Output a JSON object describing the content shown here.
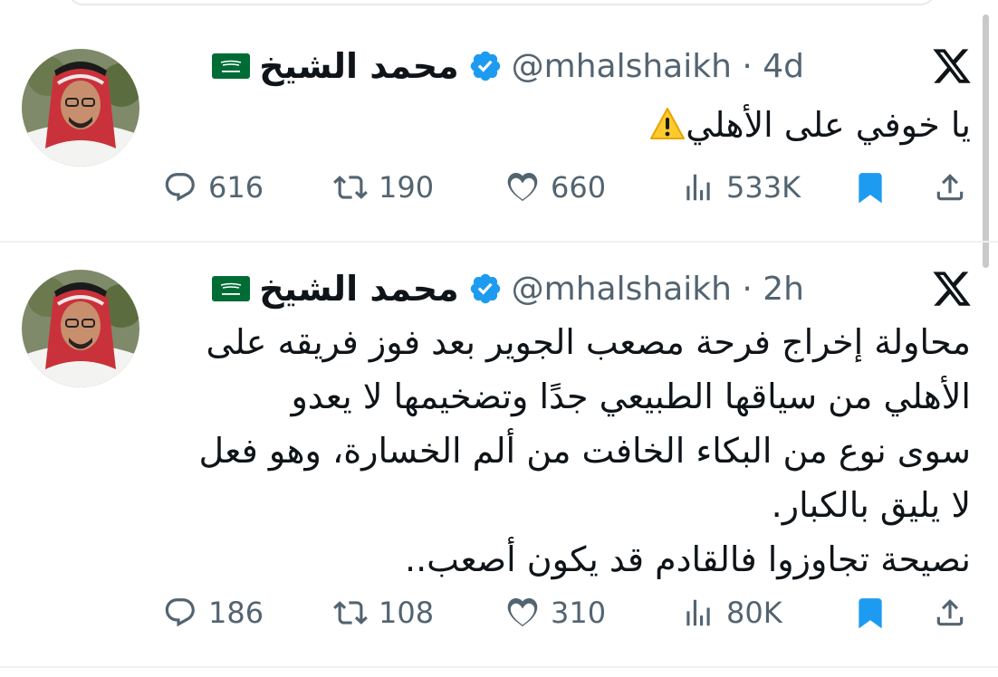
{
  "tweets": [
    {
      "display_name": "محمد الشيخ",
      "handle": "@mhalshaikh",
      "time": "4d",
      "text": "يا خوفي على الأهلي",
      "has_warning_emoji": true,
      "replies": "616",
      "retweets": "190",
      "likes": "660",
      "views": "533K",
      "bookmarked": true
    },
    {
      "display_name": "محمد الشيخ",
      "handle": "@mhalshaikh",
      "time": "2h",
      "text": "محاولة إخراج فرحة مصعب الجوير بعد فوز فريقه على\nالأهلي من سياقها الطبيعي جدًا وتضخيمها لا يعدو\nسوى نوع من البكاء الخافت من ألم الخسارة، وهو فعل\nلا يليق بالكبار.\nنصيحة تجاوزوا فالقادم قد يكون أصعب..",
      "has_warning_emoji": false,
      "replies": "186",
      "retweets": "108",
      "likes": "310",
      "views": "80K",
      "bookmarked": true
    }
  ],
  "colors": {
    "verified": "#1d9bf0",
    "bookmark": "#1d9bf0",
    "flag": "#006c35",
    "muted_text": "#536471",
    "primary_text": "#0f1419"
  },
  "icons": [
    "reply-icon",
    "retweet-icon",
    "like-icon",
    "views-icon",
    "bookmark-icon",
    "share-icon",
    "x-logo-icon",
    "verified-badge-icon",
    "saudi-flag-icon",
    "warning-icon"
  ]
}
